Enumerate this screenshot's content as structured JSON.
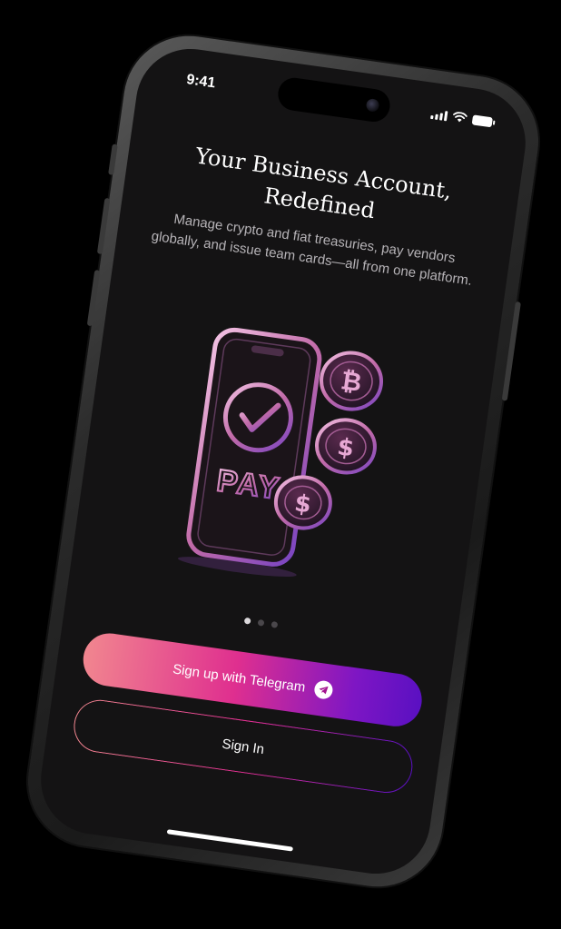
{
  "status_bar": {
    "time": "9:41",
    "icons": [
      "signal-icon",
      "wifi-icon",
      "battery-icon"
    ]
  },
  "hero": {
    "title": "Your Business Account,\nRedefined",
    "subtitle": "Manage crypto and fiat treasuries, pay vendors globally, and issue team cards—all from one platform.",
    "illustration": {
      "icons": [
        "phone-pay-icon",
        "checkmark-icon",
        "bitcoin-coin-icon",
        "dollar-coin-icon"
      ],
      "label": "PAY"
    }
  },
  "pager": {
    "total": 3,
    "active_index": 0
  },
  "actions": {
    "signup_label": "Sign up with Telegram",
    "signin_label": "Sign In"
  },
  "colors": {
    "background": "#141314",
    "gradient_start": "#f1868f",
    "gradient_mid": "#df2f8f",
    "gradient_end": "#5a10c2",
    "text_primary": "#ffffff",
    "text_secondary": "#b6b3b7"
  }
}
